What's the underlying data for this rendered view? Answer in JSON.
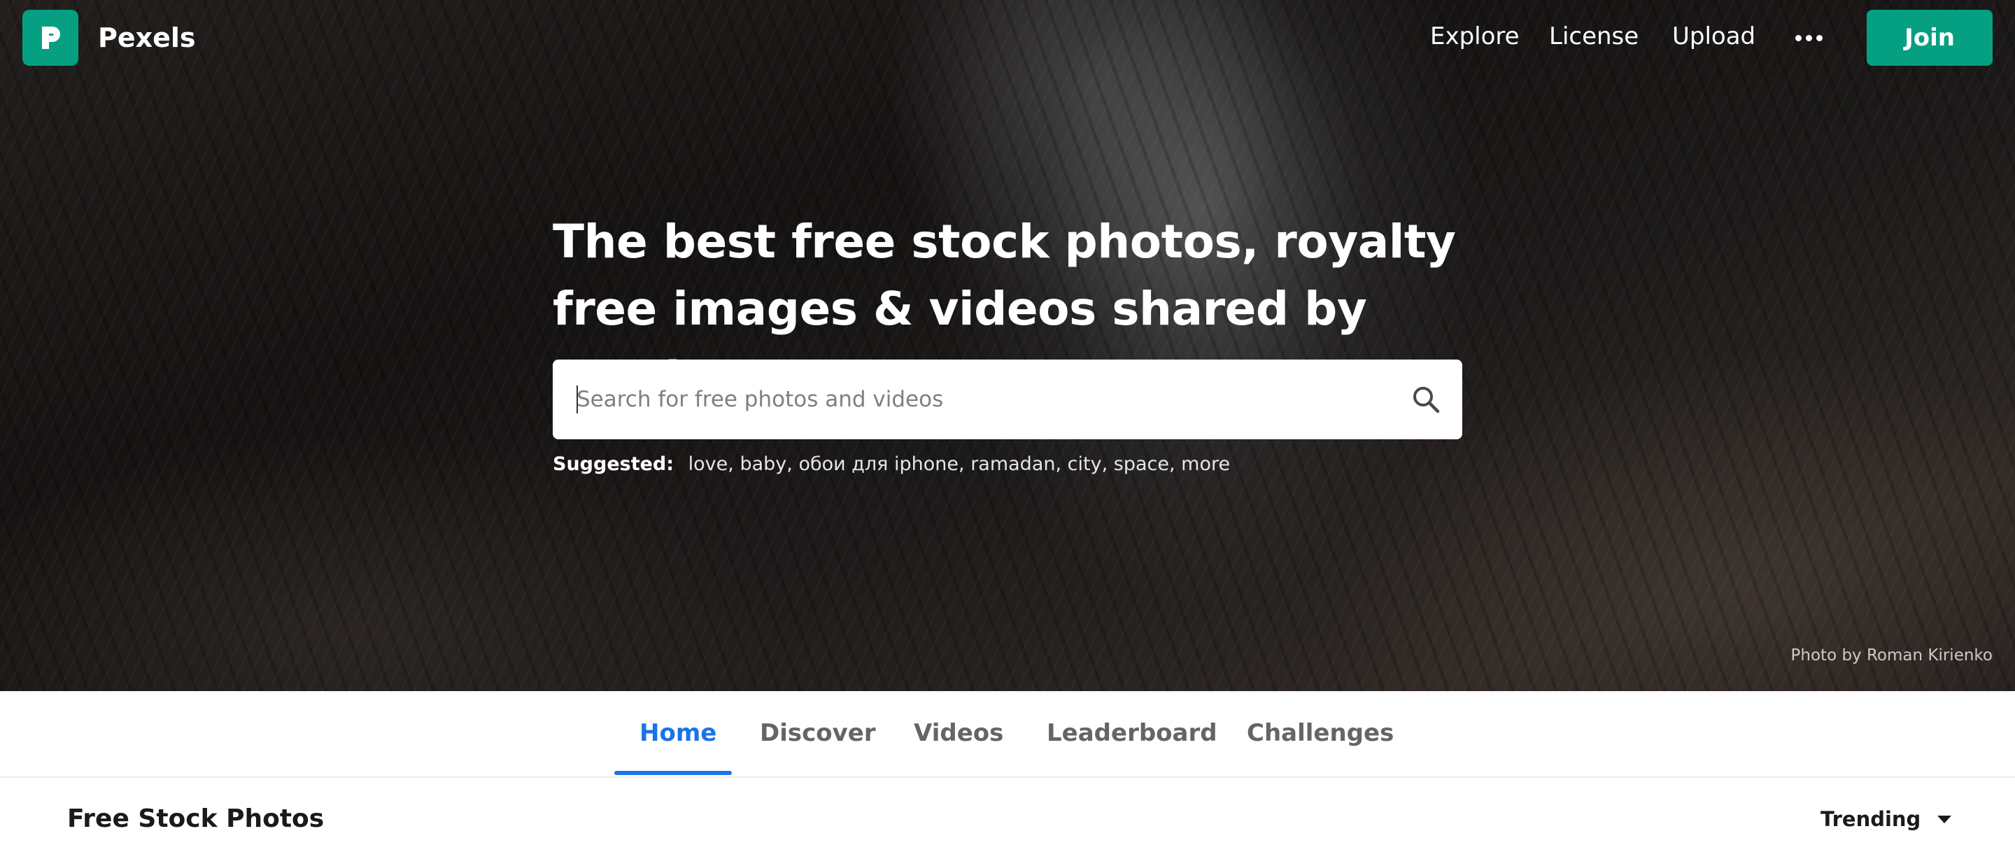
{
  "brand": {
    "name": "Pexels",
    "logo_icon": "pexels-logo-icon",
    "accent": "#05a081"
  },
  "nav": {
    "explore": "Explore",
    "license": "License",
    "upload": "Upload",
    "more_icon": "more-dots-icon",
    "join": "Join"
  },
  "hero": {
    "title": "The best free stock photos, royalty free images & videos shared by creators.",
    "search_placeholder": "Search for free photos and videos",
    "search_icon": "search-icon",
    "suggested_label": "Suggested:",
    "suggestions": [
      "love",
      "baby",
      "обои для iphone",
      "ramadan",
      "city",
      "space",
      "more"
    ],
    "photo_credit": "Photo by Roman Kirienko"
  },
  "tabs": {
    "items": [
      "Home",
      "Discover",
      "Videos",
      "Leaderboard",
      "Challenges"
    ],
    "active": "Home",
    "active_color": "#1a73e8"
  },
  "section": {
    "title": "Free Stock Photos",
    "sort": "Trending"
  }
}
